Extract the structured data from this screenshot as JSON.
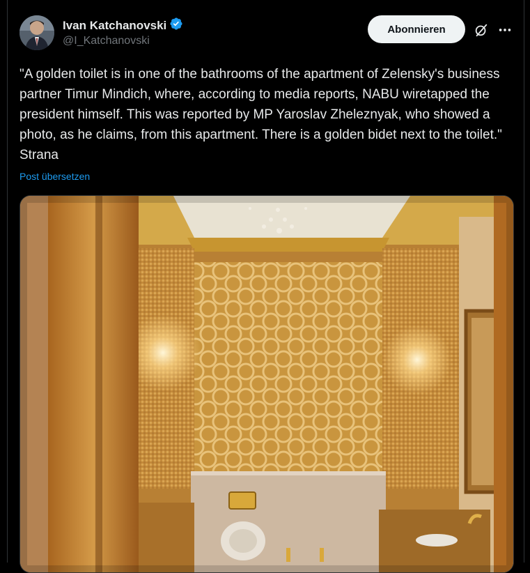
{
  "author": {
    "display_name": "Ivan Katchanovski",
    "handle": "@I_Katchanovski",
    "verified": true
  },
  "actions": {
    "follow_label": "Abonnieren",
    "grok_icon": "grok-icon",
    "more_icon": "more-icon"
  },
  "tweet": {
    "text": "\"A golden toilet is in one of the bathrooms of the apartment of Zelensky's business partner Timur Mindich, where, according to media reports, NABU wiretapped the president himself. This was reported by MP Yaroslav Zheleznyak, who showed a photo, as he claims, from this apartment. There is a golden bidet next to the toilet.\" Strana",
    "translate_label": "Post übersetzen"
  },
  "media": {
    "subject": "photo-golden-bathroom"
  },
  "colors": {
    "background": "#000000",
    "text": "#e7e9ea",
    "secondary": "#71767b",
    "link": "#1d9bf0",
    "verified": "#1d9bf0"
  }
}
